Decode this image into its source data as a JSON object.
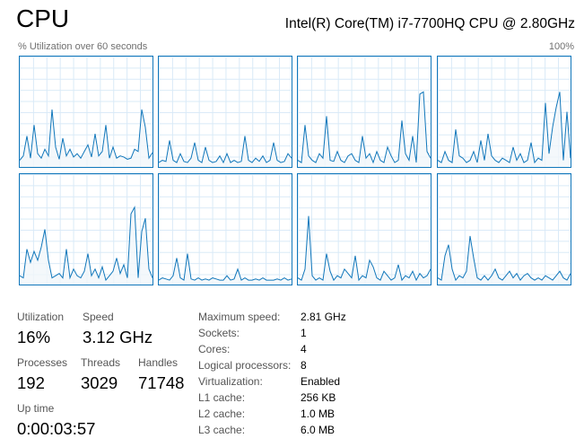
{
  "header": {
    "title": "CPU",
    "cpu_model": "Intel(R) Core(TM) i7-7700HQ CPU @ 2.80GHz",
    "graph_caption": "% Utilization over 60 seconds",
    "max_label": "100%"
  },
  "colors": {
    "graph_line": "#1177bb",
    "graph_fill": "#f1f6fa",
    "grid": "#d9eaf7"
  },
  "cores": [
    [
      6,
      10,
      28,
      8,
      38,
      12,
      8,
      16,
      10,
      52,
      18,
      7,
      26,
      10,
      16,
      9,
      12,
      8,
      14,
      20,
      9,
      30,
      10,
      14,
      38,
      8,
      18,
      8,
      10,
      9,
      7,
      8,
      16,
      14,
      52,
      36,
      8,
      13
    ],
    [
      4,
      6,
      5,
      24,
      6,
      4,
      12,
      5,
      4,
      8,
      22,
      6,
      4,
      18,
      6,
      4,
      5,
      10,
      4,
      12,
      4,
      6,
      4,
      5,
      28,
      6,
      4,
      8,
      5,
      10,
      4,
      6,
      22,
      6,
      4,
      5,
      12,
      8
    ],
    [
      6,
      4,
      38,
      10,
      6,
      4,
      12,
      8,
      46,
      6,
      5,
      14,
      6,
      4,
      10,
      12,
      6,
      4,
      28,
      8,
      12,
      4,
      14,
      6,
      4,
      18,
      10,
      4,
      6,
      42,
      12,
      6,
      28,
      4,
      66,
      68,
      14,
      8
    ],
    [
      6,
      4,
      14,
      6,
      4,
      34,
      10,
      8,
      4,
      6,
      14,
      4,
      24,
      6,
      30,
      10,
      6,
      4,
      8,
      6,
      4,
      18,
      6,
      12,
      4,
      6,
      22,
      4,
      8,
      6,
      58,
      12,
      36,
      54,
      68,
      6,
      50,
      8
    ],
    [
      8,
      6,
      32,
      20,
      30,
      22,
      34,
      50,
      22,
      6,
      8,
      10,
      6,
      32,
      6,
      14,
      8,
      6,
      12,
      28,
      8,
      14,
      6,
      16,
      4,
      8,
      12,
      24,
      10,
      18,
      6,
      64,
      70,
      6,
      48,
      60,
      14,
      6
    ],
    [
      4,
      6,
      5,
      4,
      8,
      24,
      6,
      4,
      28,
      5,
      4,
      6,
      4,
      5,
      4,
      6,
      5,
      4,
      4,
      8,
      4,
      5,
      14,
      4,
      6,
      4,
      4,
      5,
      4,
      6,
      4,
      4,
      4,
      5,
      4,
      6,
      4,
      5
    ],
    [
      6,
      4,
      14,
      62,
      8,
      4,
      6,
      4,
      28,
      12,
      4,
      8,
      6,
      14,
      10,
      6,
      26,
      4,
      8,
      6,
      22,
      16,
      6,
      4,
      12,
      8,
      4,
      6,
      18,
      4,
      8,
      6,
      12,
      4,
      10,
      6,
      8,
      14
    ],
    [
      6,
      4,
      26,
      36,
      14,
      4,
      8,
      6,
      12,
      44,
      24,
      6,
      4,
      8,
      4,
      8,
      14,
      6,
      4,
      8,
      12,
      6,
      10,
      4,
      8,
      10,
      6,
      4,
      6,
      4,
      8,
      6,
      4,
      8,
      12,
      6,
      4,
      10
    ]
  ],
  "stats": {
    "utilization": {
      "label": "Utilization",
      "value": "16%"
    },
    "speed": {
      "label": "Speed",
      "value": "3.12 GHz"
    },
    "processes": {
      "label": "Processes",
      "value": "192"
    },
    "threads": {
      "label": "Threads",
      "value": "3029"
    },
    "handles": {
      "label": "Handles",
      "value": "71748"
    },
    "uptime": {
      "label": "Up time",
      "value": "0:00:03:57"
    }
  },
  "specs": [
    {
      "key": "Maximum speed:",
      "value": "2.81 GHz"
    },
    {
      "key": "Sockets:",
      "value": "1"
    },
    {
      "key": "Cores:",
      "value": "4"
    },
    {
      "key": "Logical processors:",
      "value": "8"
    },
    {
      "key": "Virtualization:",
      "value": "Enabled"
    },
    {
      "key": "L1 cache:",
      "value": "256 KB"
    },
    {
      "key": "L2 cache:",
      "value": "1.0 MB"
    },
    {
      "key": "L3 cache:",
      "value": "6.0 MB"
    }
  ]
}
